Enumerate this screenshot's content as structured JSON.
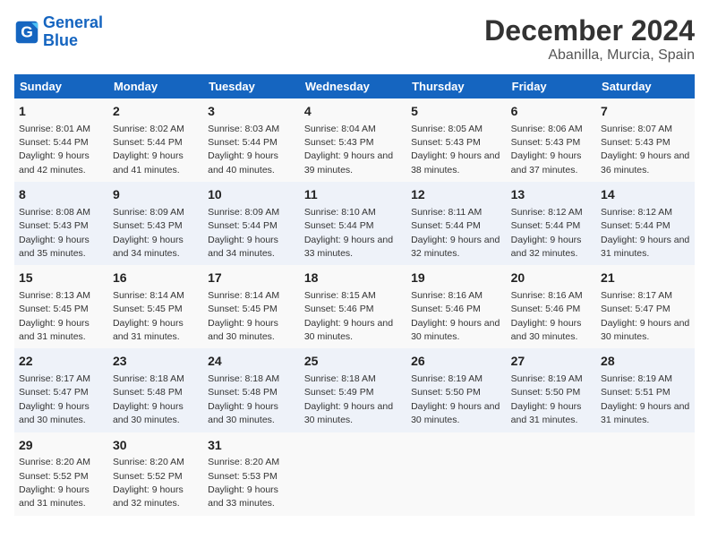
{
  "header": {
    "logo_line1": "General",
    "logo_line2": "Blue",
    "title": "December 2024",
    "subtitle": "Abanilla, Murcia, Spain"
  },
  "columns": [
    "Sunday",
    "Monday",
    "Tuesday",
    "Wednesday",
    "Thursday",
    "Friday",
    "Saturday"
  ],
  "weeks": [
    [
      {
        "day": "1",
        "info": "Sunrise: 8:01 AM\nSunset: 5:44 PM\nDaylight: 9 hours and 42 minutes."
      },
      {
        "day": "2",
        "info": "Sunrise: 8:02 AM\nSunset: 5:44 PM\nDaylight: 9 hours and 41 minutes."
      },
      {
        "day": "3",
        "info": "Sunrise: 8:03 AM\nSunset: 5:44 PM\nDaylight: 9 hours and 40 minutes."
      },
      {
        "day": "4",
        "info": "Sunrise: 8:04 AM\nSunset: 5:43 PM\nDaylight: 9 hours and 39 minutes."
      },
      {
        "day": "5",
        "info": "Sunrise: 8:05 AM\nSunset: 5:43 PM\nDaylight: 9 hours and 38 minutes."
      },
      {
        "day": "6",
        "info": "Sunrise: 8:06 AM\nSunset: 5:43 PM\nDaylight: 9 hours and 37 minutes."
      },
      {
        "day": "7",
        "info": "Sunrise: 8:07 AM\nSunset: 5:43 PM\nDaylight: 9 hours and 36 minutes."
      }
    ],
    [
      {
        "day": "8",
        "info": "Sunrise: 8:08 AM\nSunset: 5:43 PM\nDaylight: 9 hours and 35 minutes."
      },
      {
        "day": "9",
        "info": "Sunrise: 8:09 AM\nSunset: 5:43 PM\nDaylight: 9 hours and 34 minutes."
      },
      {
        "day": "10",
        "info": "Sunrise: 8:09 AM\nSunset: 5:44 PM\nDaylight: 9 hours and 34 minutes."
      },
      {
        "day": "11",
        "info": "Sunrise: 8:10 AM\nSunset: 5:44 PM\nDaylight: 9 hours and 33 minutes."
      },
      {
        "day": "12",
        "info": "Sunrise: 8:11 AM\nSunset: 5:44 PM\nDaylight: 9 hours and 32 minutes."
      },
      {
        "day": "13",
        "info": "Sunrise: 8:12 AM\nSunset: 5:44 PM\nDaylight: 9 hours and 32 minutes."
      },
      {
        "day": "14",
        "info": "Sunrise: 8:12 AM\nSunset: 5:44 PM\nDaylight: 9 hours and 31 minutes."
      }
    ],
    [
      {
        "day": "15",
        "info": "Sunrise: 8:13 AM\nSunset: 5:45 PM\nDaylight: 9 hours and 31 minutes."
      },
      {
        "day": "16",
        "info": "Sunrise: 8:14 AM\nSunset: 5:45 PM\nDaylight: 9 hours and 31 minutes."
      },
      {
        "day": "17",
        "info": "Sunrise: 8:14 AM\nSunset: 5:45 PM\nDaylight: 9 hours and 30 minutes."
      },
      {
        "day": "18",
        "info": "Sunrise: 8:15 AM\nSunset: 5:46 PM\nDaylight: 9 hours and 30 minutes."
      },
      {
        "day": "19",
        "info": "Sunrise: 8:16 AM\nSunset: 5:46 PM\nDaylight: 9 hours and 30 minutes."
      },
      {
        "day": "20",
        "info": "Sunrise: 8:16 AM\nSunset: 5:46 PM\nDaylight: 9 hours and 30 minutes."
      },
      {
        "day": "21",
        "info": "Sunrise: 8:17 AM\nSunset: 5:47 PM\nDaylight: 9 hours and 30 minutes."
      }
    ],
    [
      {
        "day": "22",
        "info": "Sunrise: 8:17 AM\nSunset: 5:47 PM\nDaylight: 9 hours and 30 minutes."
      },
      {
        "day": "23",
        "info": "Sunrise: 8:18 AM\nSunset: 5:48 PM\nDaylight: 9 hours and 30 minutes."
      },
      {
        "day": "24",
        "info": "Sunrise: 8:18 AM\nSunset: 5:48 PM\nDaylight: 9 hours and 30 minutes."
      },
      {
        "day": "25",
        "info": "Sunrise: 8:18 AM\nSunset: 5:49 PM\nDaylight: 9 hours and 30 minutes."
      },
      {
        "day": "26",
        "info": "Sunrise: 8:19 AM\nSunset: 5:50 PM\nDaylight: 9 hours and 30 minutes."
      },
      {
        "day": "27",
        "info": "Sunrise: 8:19 AM\nSunset: 5:50 PM\nDaylight: 9 hours and 31 minutes."
      },
      {
        "day": "28",
        "info": "Sunrise: 8:19 AM\nSunset: 5:51 PM\nDaylight: 9 hours and 31 minutes."
      }
    ],
    [
      {
        "day": "29",
        "info": "Sunrise: 8:20 AM\nSunset: 5:52 PM\nDaylight: 9 hours and 31 minutes."
      },
      {
        "day": "30",
        "info": "Sunrise: 8:20 AM\nSunset: 5:52 PM\nDaylight: 9 hours and 32 minutes."
      },
      {
        "day": "31",
        "info": "Sunrise: 8:20 AM\nSunset: 5:53 PM\nDaylight: 9 hours and 33 minutes."
      },
      {
        "day": "",
        "info": ""
      },
      {
        "day": "",
        "info": ""
      },
      {
        "day": "",
        "info": ""
      },
      {
        "day": "",
        "info": ""
      }
    ]
  ]
}
